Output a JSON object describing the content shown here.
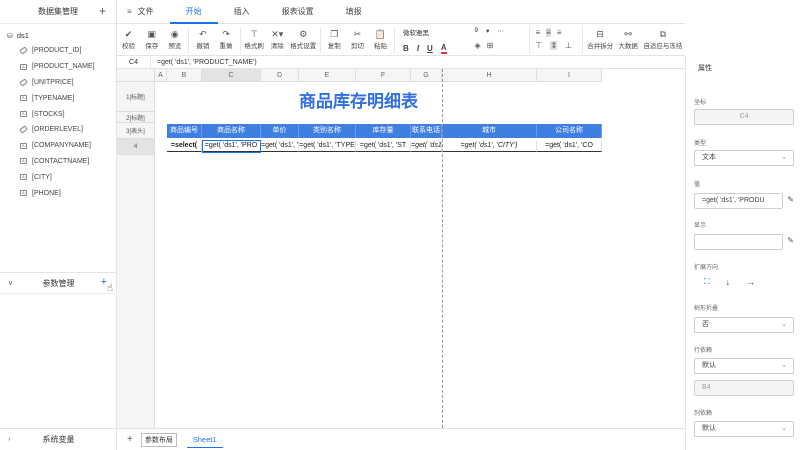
{
  "left": {
    "dataset_header": "数据集管理",
    "add_symbol": "+",
    "dataset_name": "ds1",
    "fields": [
      "[PRODUCT_ID]",
      "[PRODUCT_NAME]",
      "[UNITPRICE]",
      "[TYPENAME]",
      "[STOCKS]",
      "[ORDERLEVEL]",
      "[COMPANYNAME]",
      "[CONTACTNAME]",
      "[CITY]",
      "[PHONE]"
    ],
    "param_header": "参数管理",
    "system_header": "系统变量"
  },
  "top": {
    "file": "文件",
    "tabs": [
      "开始",
      "插入",
      "报表设置",
      "填报"
    ]
  },
  "toolbar": {
    "buttons1": [
      "校验",
      "保存",
      "预览"
    ],
    "buttons2": [
      "撤销",
      "重做"
    ],
    "buttons3": [
      "格式刷",
      "清除",
      "格式设置"
    ],
    "buttons4": [
      "复制",
      "剪切",
      "粘贴"
    ],
    "font_name": "微软雅黑",
    "font_size": "9",
    "buttons5": [
      "合并拆分",
      "大数据",
      "自适应与冻结"
    ]
  },
  "formula": {
    "cell_ref": "C4",
    "value": "=get( 'ds1', 'PRODUCT_NAME')"
  },
  "grid": {
    "columns": [
      "A",
      "B",
      "C",
      "D",
      "E",
      "F",
      "G",
      "H",
      "I"
    ],
    "rows": [
      "1[标题]",
      "2[标题]",
      "3[表头]",
      "4"
    ],
    "title": "商品库存明细表",
    "headers": [
      "商品编号",
      "商品名称",
      "单价",
      "类别名称",
      "库存量",
      "联系电话",
      "城市",
      "公司名称"
    ],
    "data": [
      "=select(",
      "=get( 'ds1', 'PRO",
      "=get( 'ds1', '",
      "=get( 'ds1', 'TYPE",
      "=get( 'ds1', 'ST",
      "=get( 'ds1', 'PHO",
      "=get( 'ds1', 'CITY')",
      "=get( 'ds1', 'CO"
    ]
  },
  "bottom": {
    "add": "+",
    "param_layout": "参数布局",
    "sheet": "Sheet1"
  },
  "right": {
    "header": "属性",
    "coord_label": "坐标",
    "coord_value": "C4",
    "type_label": "类型",
    "type_value": "文本",
    "value_label": "值",
    "value_value": "=get( 'ds1', 'PRODU",
    "display_label": "显示",
    "display_value": "",
    "expand_label": "扩展方向",
    "expand_icons": [
      "⛶",
      "↓",
      "→"
    ],
    "tree_label": "树形折叠",
    "tree_value": "否",
    "rowdep_label": "行依赖",
    "rowdep_value": "默认",
    "rowdep_cell": "B4",
    "coldep_label": "列依赖",
    "coldep_value": "默认"
  }
}
